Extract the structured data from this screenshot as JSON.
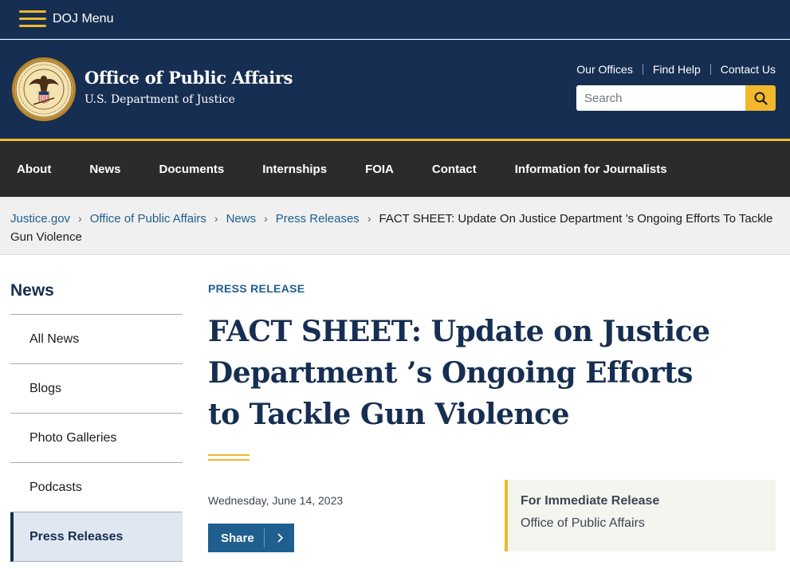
{
  "topbar": {
    "menu_label": "DOJ Menu"
  },
  "header": {
    "title": "Office of Public Affairs",
    "subtitle": "U.S. Department of Justice",
    "util_links": [
      "Our Offices",
      "Find Help",
      "Contact Us"
    ],
    "search_placeholder": "Search"
  },
  "nav": [
    "About",
    "News",
    "Documents",
    "Internships",
    "FOIA",
    "Contact",
    "Information for Journalists"
  ],
  "breadcrumb": {
    "links": [
      "Justice.gov",
      "Office of Public Affairs",
      "News",
      "Press Releases"
    ],
    "current": "FACT SHEET: Update On Justice Department ’s Ongoing Efforts To Tackle Gun Violence"
  },
  "sidebar": {
    "title": "News",
    "items": [
      "All News",
      "Blogs",
      "Photo Galleries",
      "Podcasts",
      "Press Releases"
    ],
    "active_index": 4
  },
  "article": {
    "eyebrow": "PRESS RELEASE",
    "headline": "FACT SHEET: Update on Justice Department ’s Ongoing Efforts to Tackle Gun Violence",
    "date": "Wednesday, June 14, 2023",
    "share_label": "Share",
    "release_title": "For Immediate Release",
    "release_office": "Office of Public Affairs"
  },
  "colors": {
    "navy": "#162e51",
    "gold": "#f2b72d",
    "link": "#1f5f8f",
    "nav_bg": "#2b2b2b"
  },
  "icons": [
    "hamburger-icon",
    "doj-seal-logo",
    "search-icon",
    "chevron-right-icon"
  ]
}
